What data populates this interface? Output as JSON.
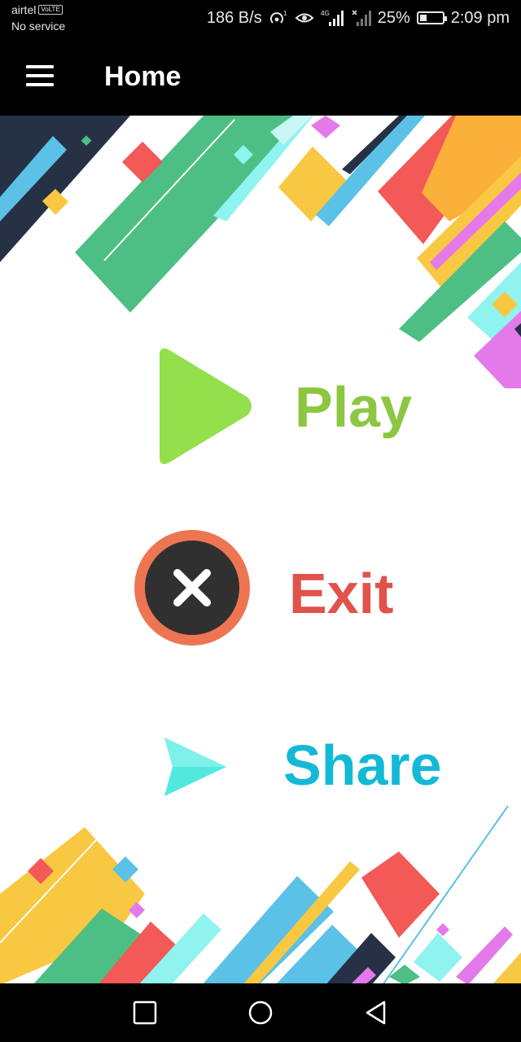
{
  "status_bar": {
    "carrier": "airtel",
    "volte_badge": "VoLTE",
    "service": "No service",
    "network_speed": "186 B/s",
    "hotspot_count": "1",
    "network_type": "4G",
    "battery": "25%",
    "time": "2:09 pm"
  },
  "app_bar": {
    "title": "Home",
    "menu_icon": "hamburger-menu-icon"
  },
  "menu": {
    "play": {
      "label": "Play",
      "icon": "play-icon",
      "color": "#8dc641"
    },
    "exit": {
      "label": "Exit",
      "icon": "close-circle-icon",
      "color": "#e0524a"
    },
    "share": {
      "label": "Share",
      "icon": "send-icon",
      "color": "#14b9d6"
    }
  },
  "nav_bar": {
    "recents_icon": "square-icon",
    "home_icon": "circle-icon",
    "back_icon": "triangle-back-icon"
  }
}
